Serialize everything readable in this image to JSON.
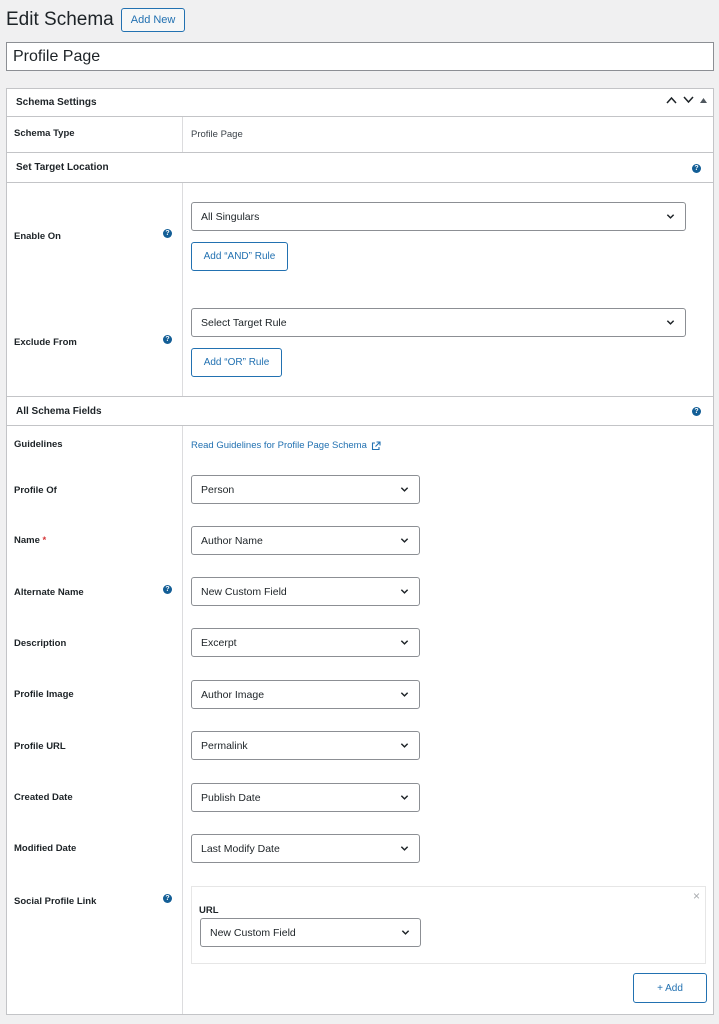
{
  "header": {
    "title": "Edit Schema",
    "add_new": "Add New"
  },
  "post_title": "Profile Page",
  "settings": {
    "heading": "Schema Settings",
    "schema_type_label": "Schema Type",
    "schema_type_value": "Profile Page"
  },
  "target": {
    "heading": "Set Target Location",
    "enable_on_label": "Enable On",
    "enable_on_value": "All Singulars",
    "and_rule": "Add “AND” Rule",
    "exclude_label": "Exclude From",
    "exclude_value": "Select Target Rule",
    "or_rule": "Add “OR” Rule"
  },
  "fields": {
    "heading": "All Schema Fields",
    "guidelines_label": "Guidelines",
    "guidelines_link": "Read Guidelines for Profile Page Schema",
    "rows": [
      {
        "label": "Profile Of",
        "value": "Person"
      },
      {
        "label": "Name",
        "value": "Author Name",
        "required": "*"
      },
      {
        "label": "Alternate Name",
        "value": "New Custom Field"
      },
      {
        "label": "Description",
        "value": "Excerpt"
      },
      {
        "label": "Profile Image",
        "value": "Author Image"
      },
      {
        "label": "Profile URL",
        "value": "Permalink"
      },
      {
        "label": "Created Date",
        "value": "Publish Date"
      },
      {
        "label": "Modified Date",
        "value": "Last Modify Date"
      }
    ],
    "social_label": "Social Profile Link",
    "url_label": "URL",
    "url_value": "New Custom Field",
    "add_button": "+ Add",
    "close": "×"
  },
  "help_glyph": "?",
  "icons": {
    "help": "help-icon",
    "chevron": "chevron-down-icon",
    "external": "external-link-icon"
  },
  "colors": {
    "accent": "#2271b1",
    "help": "#135e96",
    "required": "#d63638"
  }
}
